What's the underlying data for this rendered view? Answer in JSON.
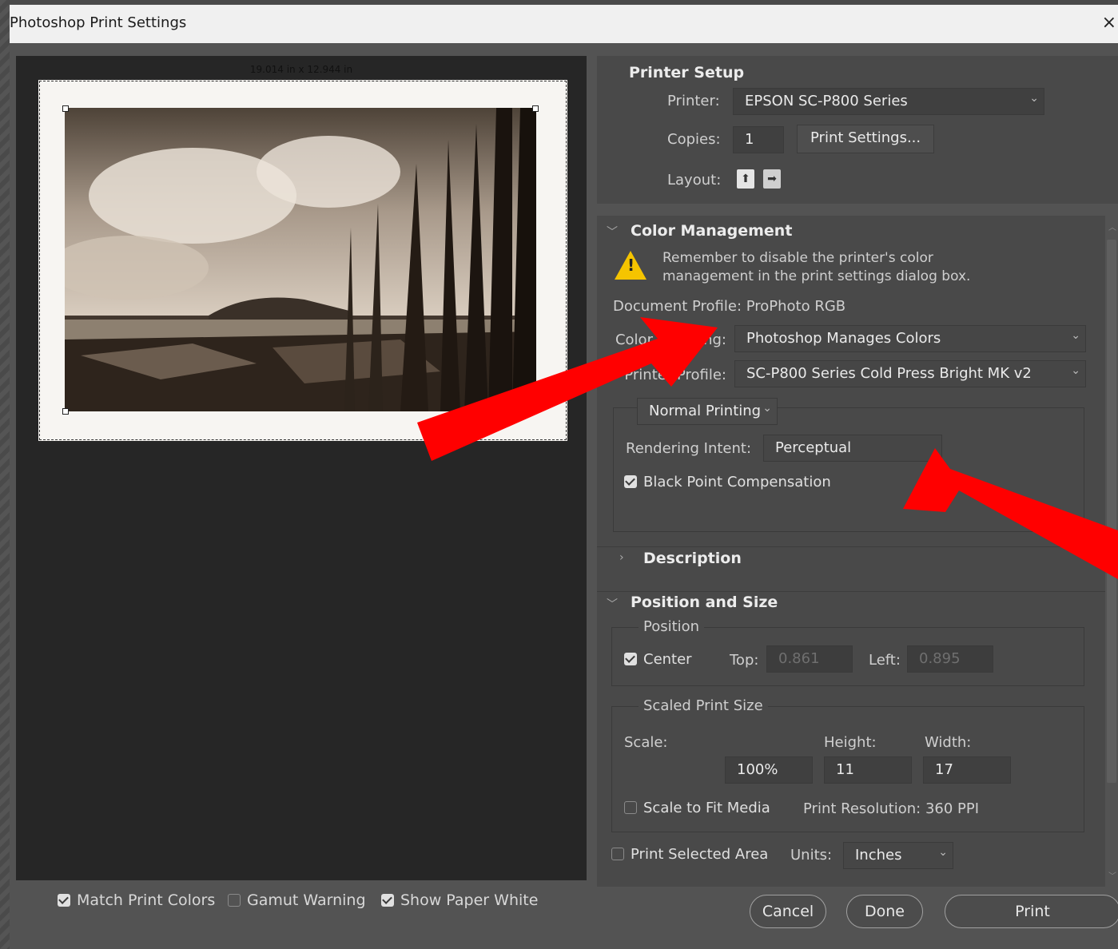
{
  "window": {
    "title": "Photoshop Print Settings",
    "close_glyph": "×"
  },
  "preview": {
    "dims": "19.014 in x 12.944 in"
  },
  "preview_options": {
    "match_print_colors": {
      "label": "Match Print Colors",
      "checked": true
    },
    "gamut_warning": {
      "label": "Gamut Warning",
      "checked": false
    },
    "show_paper_white": {
      "label": "Show Paper White",
      "checked": true
    }
  },
  "printer_setup": {
    "title": "Printer Setup",
    "printer_label": "Printer:",
    "printer_value": "EPSON SC-P800 Series",
    "copies_label": "Copies:",
    "copies_value": "1",
    "print_settings_button": "Print Settings...",
    "layout_label": "Layout:"
  },
  "color_management": {
    "title": "Color Management",
    "warning_line1": "Remember to disable the printer's color",
    "warning_line2": "management in the print settings dialog box.",
    "document_profile": "Document Profile: ProPhoto RGB",
    "color_handling_label": "Color Handling:",
    "color_handling_value": "Photoshop Manages Colors",
    "printer_profile_label": "Printer Profile:",
    "printer_profile_value": "SC-P800 Series Cold Press Bright MK v2",
    "printing_mode": "Normal Printing",
    "rendering_intent_label": "Rendering Intent:",
    "rendering_intent_value": "Perceptual",
    "bpc_label": "Black Point Compensation",
    "bpc_checked": true
  },
  "description": {
    "title": "Description"
  },
  "position_size": {
    "title": "Position and Size",
    "position_group": "Position",
    "center_label": "Center",
    "top_label": "Top:",
    "top_value": "0.861",
    "left_label": "Left:",
    "left_value": "0.895",
    "scaled_group": "Scaled Print Size",
    "scale_label": "Scale:",
    "height_label": "Height:",
    "width_label": "Width:",
    "scale_value": "100%",
    "height_value": "11",
    "width_value": "17",
    "fit_media_label": "Scale to Fit Media",
    "resolution": "Print Resolution: 360 PPI",
    "print_selected_label": "Print Selected Area",
    "units_label": "Units:",
    "units_value": "Inches"
  },
  "actions": {
    "cancel": "Cancel",
    "done": "Done",
    "print": "Print"
  },
  "colors": {
    "annotation_arrow": "#ff0000",
    "warning": "#f5c400"
  }
}
